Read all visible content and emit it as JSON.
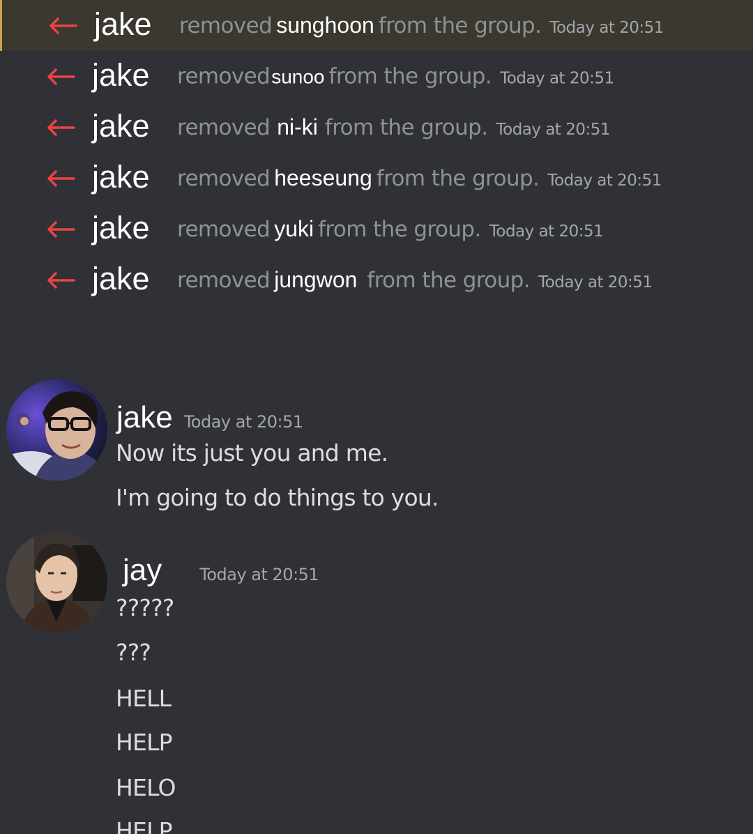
{
  "system_messages": [
    {
      "actor": "jake",
      "verb": "removed",
      "target": "sunghoon",
      "tail": "from the group.",
      "time": "Today at 20:51"
    },
    {
      "actor": "jake",
      "verb": "removed",
      "target": "sunoo",
      "tail": "from the group.",
      "time": "Today at 20:51"
    },
    {
      "actor": "jake",
      "verb": "removed",
      "target": "ni-ki",
      "tail": "from the group.",
      "time": "Today at 20:51"
    },
    {
      "actor": "jake",
      "verb": "removed",
      "target": "heeseung",
      "tail": "from the group.",
      "time": "Today at 20:51"
    },
    {
      "actor": "jake",
      "verb": "removed",
      "target": "yuki",
      "tail": "from the group.",
      "time": "Today at 20:51"
    },
    {
      "actor": "jake",
      "verb": "removed",
      "target": "jungwon",
      "tail": "from the group.",
      "time": "Today at 20:51"
    }
  ],
  "messages": [
    {
      "author": "jake",
      "time": "Today at 20:51",
      "lines": [
        "Now its just you and me.",
        "I'm going to do things to you."
      ]
    },
    {
      "author": "jay",
      "time": "Today at 20:51",
      "lines": [
        "?????",
        "???",
        "HELL",
        "HELP",
        "HELO",
        "HELP"
      ]
    }
  ],
  "colors": {
    "background": "#2f3136",
    "highlight_background": "#3a382f",
    "highlight_bar": "#c9a24a",
    "removed_arrow": "#ed4245",
    "muted_text": "#8e9297",
    "message_text": "#dcddde"
  },
  "icons": {
    "removed_arrow": "arrow-left-icon"
  }
}
